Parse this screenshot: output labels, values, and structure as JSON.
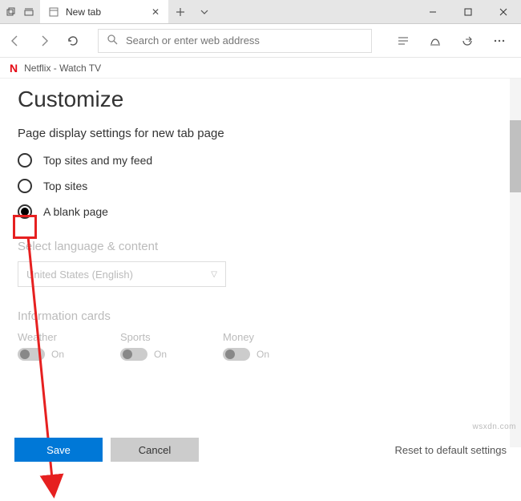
{
  "titlebar": {
    "tab_title": "New tab",
    "new_tab_tooltip": "+"
  },
  "window_controls": {
    "minimize": "−",
    "maximize": "☐",
    "close": "✕"
  },
  "navbar": {
    "search_placeholder": "Search or enter web address"
  },
  "subbar": {
    "bookmark_label": "Netflix - Watch TV"
  },
  "page": {
    "heading": "Customize",
    "section_label": "Page display settings for new tab page",
    "options": {
      "opt1": "Top sites and my feed",
      "opt2": "Top sites",
      "opt3": "A blank page"
    },
    "language": {
      "section_title": "Select language & content",
      "selected": "United States (English)"
    },
    "cards": {
      "section_title": "Information cards",
      "col1": "Weather",
      "col2": "Sports",
      "col3": "Money",
      "toggle_label": "On"
    }
  },
  "footer": {
    "save": "Save",
    "cancel": "Cancel",
    "reset": "Reset to default settings"
  },
  "watermark": "wsxdn.com"
}
